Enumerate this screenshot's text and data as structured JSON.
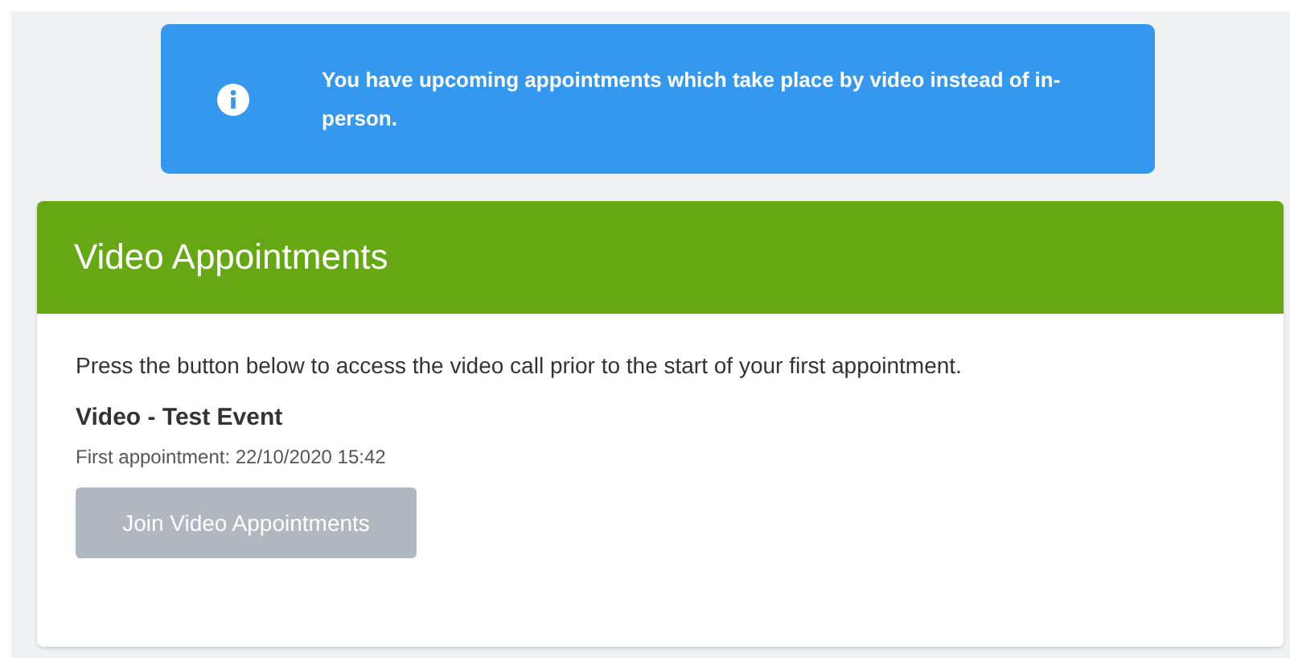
{
  "alert": {
    "message": "You have upcoming appointments which take place by video instead of in-person."
  },
  "card": {
    "title": "Video Appointments",
    "intro": "Press the button below to access the video call prior to the start of your first appointment.",
    "event": {
      "name": "Video - Test Event",
      "first_appointment": "First appointment: 22/10/2020 15:42"
    },
    "button": {
      "label": "Join Video Appointments",
      "disabled": true
    }
  }
}
